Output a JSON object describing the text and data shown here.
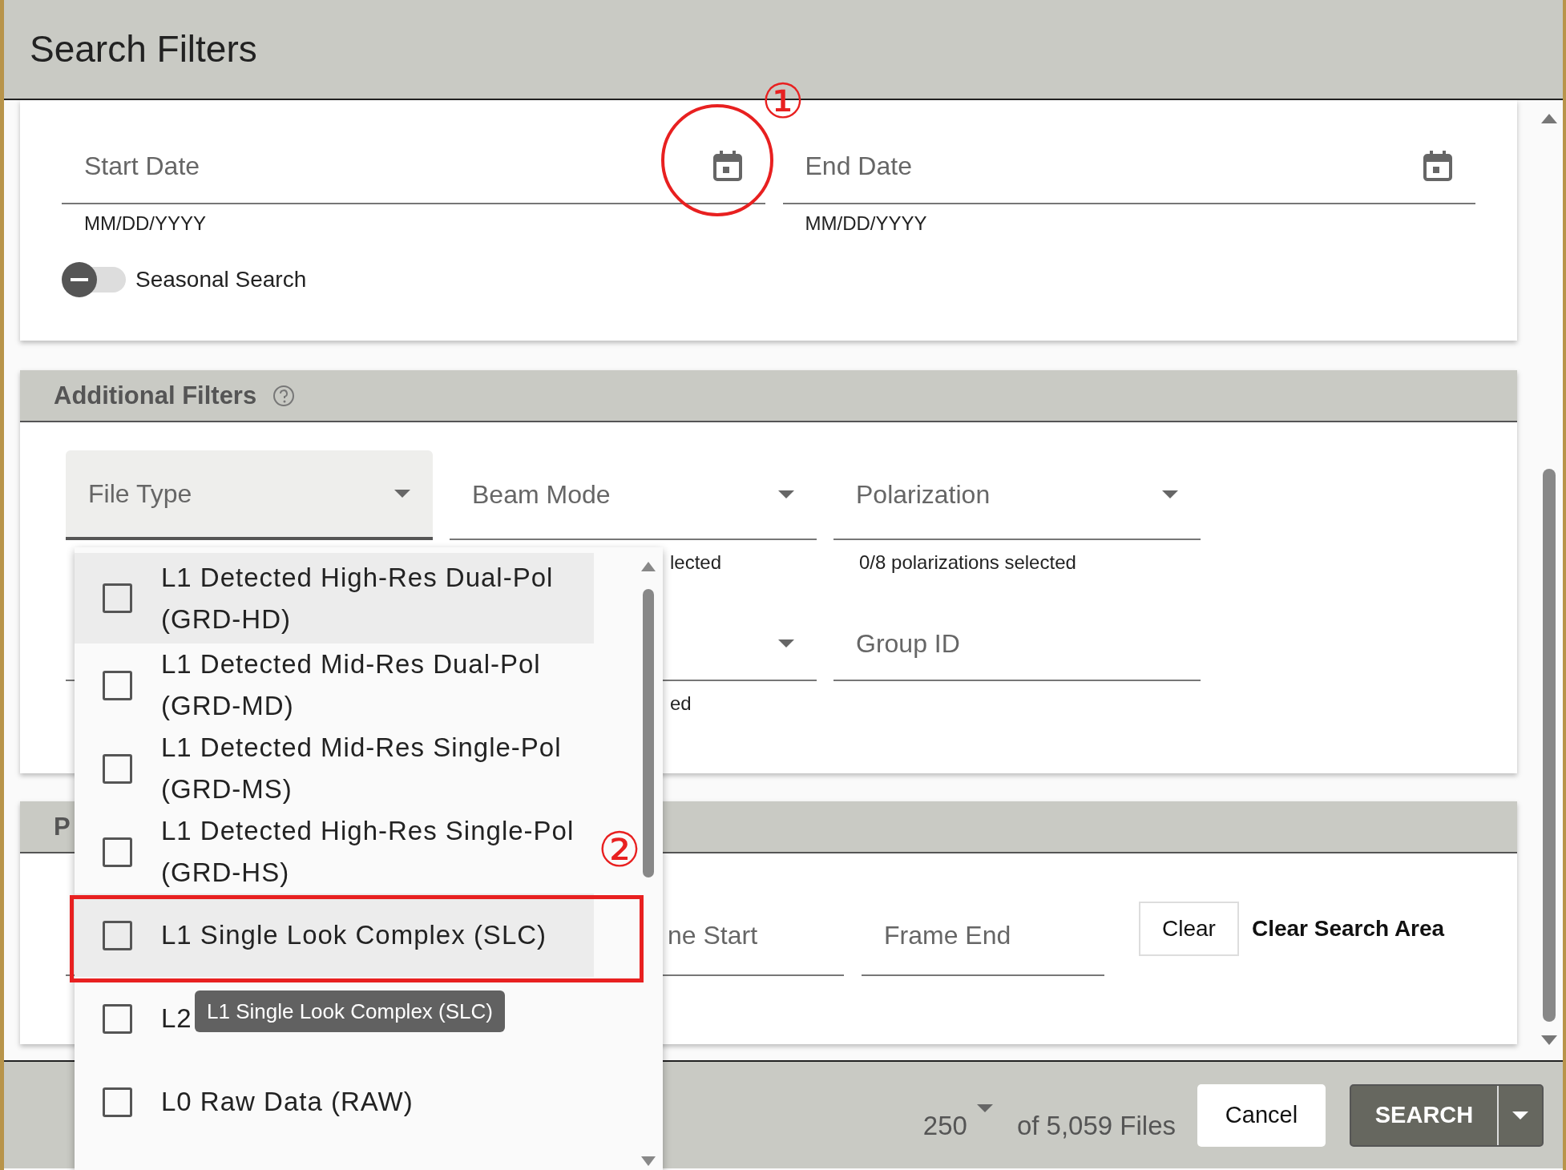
{
  "dialog": {
    "title": "Search Filters"
  },
  "date_filters": {
    "start_date": {
      "label": "Start Date",
      "helper": "MM/DD/YYYY"
    },
    "end_date": {
      "label": "End Date",
      "helper": "MM/DD/YYYY"
    },
    "seasonal_search": {
      "label": "Seasonal Search",
      "on": false
    }
  },
  "additional_filters": {
    "title": "Additional Filters",
    "rows": [
      [
        {
          "kind": "select",
          "label": "File Type",
          "focused": true
        },
        {
          "kind": "select",
          "label": "Beam Mode",
          "focused": false,
          "helper": "lected"
        },
        {
          "kind": "select",
          "label": "Polarization",
          "focused": false,
          "helper": "0/8 polarizations selected"
        }
      ],
      [
        "",
        {
          "kind": "select",
          "focused": false,
          "helper": "ed"
        },
        {
          "kind": "text",
          "label": "Group ID",
          "focused": false
        }
      ]
    ]
  },
  "area_filters": {
    "title": "P",
    "fields": [
      {
        "label": "ne Start"
      },
      {
        "label": "Frame End"
      }
    ],
    "clear_button": "Clear",
    "clear_text": "Clear Search Area"
  },
  "footer": {
    "page_size": "250",
    "count_text": "of 5,059 Files",
    "cancel_button": "Cancel",
    "search_button": "SEARCH"
  },
  "file_type_menu": {
    "items": [
      {
        "label": "L1 Detected High-Res Dual-Pol (GRD-HD)",
        "checked": false,
        "highlighted": true
      },
      {
        "label": "L1 Detected Mid-Res Dual-Pol (GRD-MD)",
        "checked": false,
        "highlighted": false
      },
      {
        "label": "L1 Detected Mid-Res Single-Pol (GRD-MS)",
        "checked": false,
        "highlighted": false
      },
      {
        "label": "L1 Detected High-Res Single-Pol (GRD-HS)",
        "checked": false,
        "highlighted": false
      },
      {
        "label": "L1 Single Look Complex (SLC)",
        "checked": false,
        "highlighted": true
      },
      {
        "label": "L2",
        "checked": false,
        "highlighted": false
      },
      {
        "label": "L0 Raw Data (RAW)",
        "checked": false,
        "highlighted": false
      }
    ],
    "tooltip": "L1 Single Look Complex (SLC)"
  },
  "annotations": [
    {
      "kind": "circle",
      "label": "①"
    },
    {
      "kind": "box",
      "label": "②"
    }
  ]
}
